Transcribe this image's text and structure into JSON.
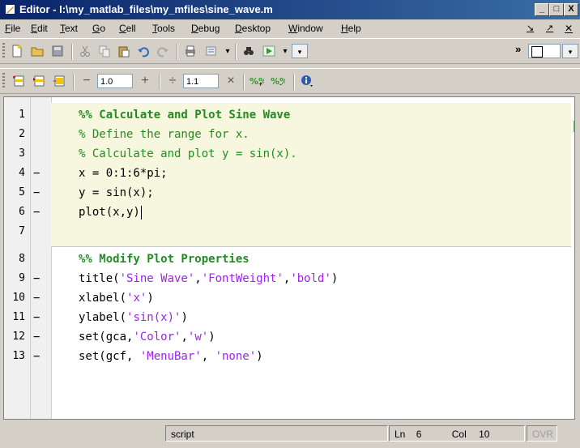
{
  "window": {
    "title": "Editor - I:\\my_matlab_files\\my_mfiles\\sine_wave.m",
    "minimize": "_",
    "maximize": "□",
    "close": "X"
  },
  "menu": [
    "File",
    "Edit",
    "Text",
    "Go",
    "Cell",
    "Tools",
    "Debug",
    "Desktop",
    "Window",
    "Help"
  ],
  "menu_right": [
    "↘",
    "↗",
    "✕"
  ],
  "toolbar1": {
    "icons": [
      "new-file-icon",
      "open-icon",
      "save-icon",
      "cut-icon",
      "copy-icon",
      "paste-icon",
      "undo-icon",
      "redo-icon",
      "print-icon",
      "find-files-icon",
      "find-icon",
      "run-icon",
      "stack-dropdown"
    ],
    "overflow": "»"
  },
  "toolbar2": {
    "decrement_label": "−",
    "spin1_value": "1.0",
    "increment_label": "+",
    "divide_label": "÷",
    "spin2_value": "1.1",
    "multiply_label": "×"
  },
  "editor": {
    "lines": [
      {
        "num": "1",
        "exec": "",
        "kind": "cell",
        "text": "%% Calculate and Plot Sine Wave"
      },
      {
        "num": "2",
        "exec": "",
        "kind": "comment",
        "text": "% Define the range for x."
      },
      {
        "num": "3",
        "exec": "",
        "kind": "comment",
        "text": "% Calculate and plot y = sin(x)."
      },
      {
        "num": "4",
        "exec": "−",
        "kind": "code",
        "text": "x = 0:1:6*pi;"
      },
      {
        "num": "5",
        "exec": "−",
        "kind": "code",
        "text": "y = sin(x);"
      },
      {
        "num": "6",
        "exec": "−",
        "kind": "code",
        "text": "plot(x,y)"
      },
      {
        "num": "7",
        "exec": "",
        "kind": "blank",
        "text": ""
      },
      {
        "num": "8",
        "exec": "",
        "kind": "cell",
        "text": "%% Modify Plot Properties"
      },
      {
        "num": "9",
        "exec": "−",
        "kind": "code",
        "text": "title('Sine Wave','FontWeight','bold')"
      },
      {
        "num": "10",
        "exec": "−",
        "kind": "code",
        "text": "xlabel('x')"
      },
      {
        "num": "11",
        "exec": "−",
        "kind": "code",
        "text": "ylabel('sin(x)')"
      },
      {
        "num": "12",
        "exec": "−",
        "kind": "code",
        "text": "set(gca,'Color','w')"
      },
      {
        "num": "13",
        "exec": "−",
        "kind": "code",
        "text": "set(gcf, 'MenuBar', 'none')"
      }
    ]
  },
  "status": {
    "mode": "script",
    "ln_label": "Ln",
    "ln_value": "6",
    "col_label": "Col",
    "col_value": "10",
    "ovr": "OVR"
  },
  "colors": {
    "comment": "#228b22",
    "string": "#a020f0",
    "cell_highlight": "#f7f7df"
  }
}
